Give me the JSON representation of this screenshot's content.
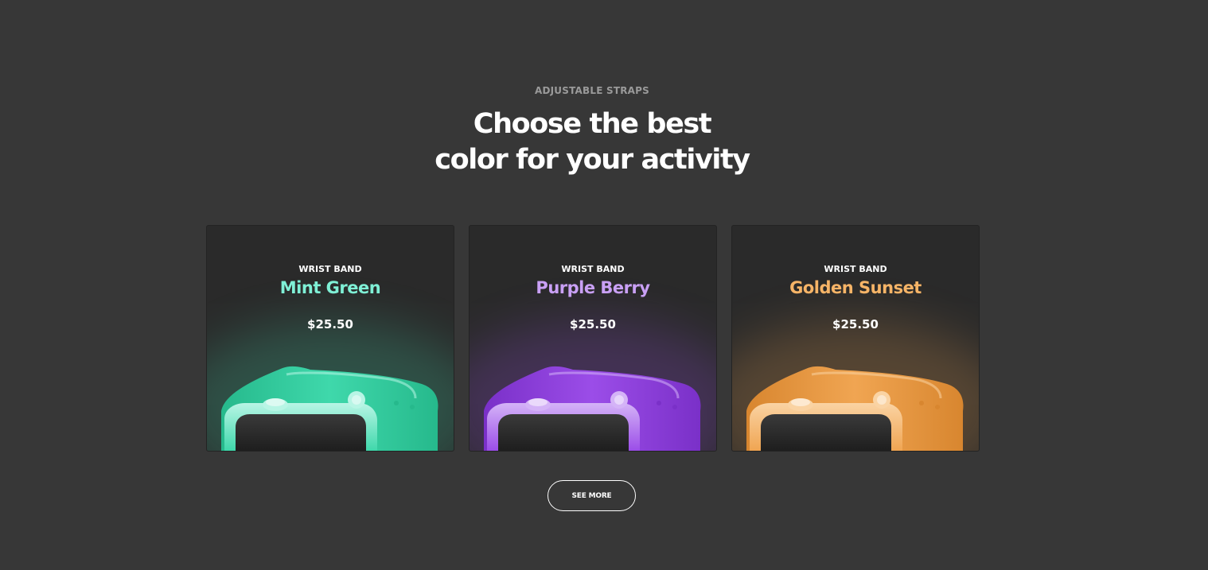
{
  "section": {
    "eyebrow": "ADJUSTABLE STRAPS",
    "headline_line1": "Choose the best",
    "headline_line2": "color for your activity"
  },
  "products": [
    {
      "tag": "WRIST BAND",
      "name": "Mint Green",
      "price": "$25.50",
      "color": "#7ff0d6",
      "band_color": "#3fd8ab",
      "band_dark": "#26b98c",
      "frame_color": "#b8f5e5",
      "icon": "watch-icon"
    },
    {
      "tag": "WRIST BAND",
      "name": "Purple Berry",
      "price": "$25.50",
      "color": "#c9a0f5",
      "band_color": "#9b4de8",
      "band_dark": "#7a30c8",
      "frame_color": "#d4b3f7",
      "icon": "watch-icon"
    },
    {
      "tag": "WRIST BAND",
      "name": "Golden Sunset",
      "price": "$25.50",
      "color": "#f6b467",
      "band_color": "#f0a552",
      "band_dark": "#d8862f",
      "frame_color": "#fad3a3",
      "icon": "watch-icon"
    }
  ],
  "cta": {
    "label": "SEE MORE"
  },
  "colors": {
    "background": "#373737",
    "card": "#2a2a2a",
    "eyebrow": "#9a9a9a"
  }
}
